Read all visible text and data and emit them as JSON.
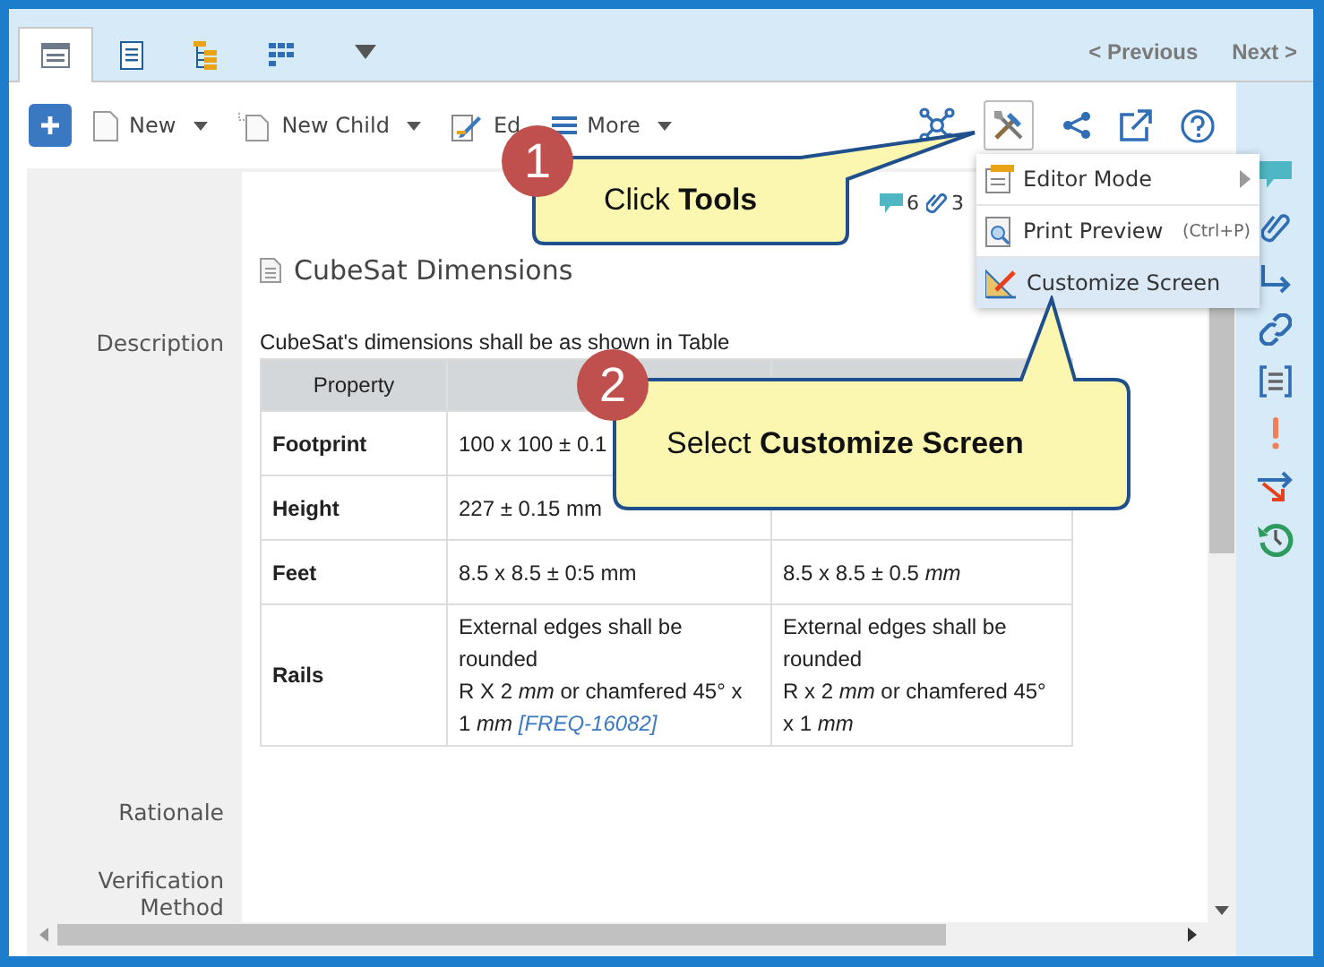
{
  "tabs": [
    {
      "selected": true
    },
    {
      "selected": false
    },
    {
      "selected": false
    },
    {
      "selected": false
    }
  ],
  "navigation": {
    "previous": "< Previous",
    "next": "Next >"
  },
  "toolbar": {
    "buttons": [
      {
        "kind": "new",
        "label": "New",
        "dropdown": true
      },
      {
        "kind": "new-child",
        "label": "New Child",
        "dropdown": true
      },
      {
        "kind": "edit",
        "label": "Ed",
        "dropdown": false
      },
      {
        "kind": "more",
        "label": "More",
        "dropdown": true
      }
    ],
    "tools": {
      "selected": true
    }
  },
  "menu": {
    "items": [
      {
        "kind": "editor",
        "label": "Editor Mode",
        "submenu": true,
        "selected": false
      },
      {
        "kind": "preview",
        "label": "Print Preview",
        "shortcut": "(Ctrl+P)",
        "submenu": false,
        "selected": false
      },
      {
        "kind": "customize",
        "label": "Customize Screen",
        "submenu": false,
        "selected": true
      }
    ]
  },
  "item": {
    "title": "CubeSat Dimensions",
    "comments": "6",
    "attachments": "3"
  },
  "description": {
    "label": "Description",
    "text": "CubeSat's dimensions shall be as shown in Table",
    "table": {
      "columns": [
        "Property"
      ],
      "rows": [
        {
          "name": "Footprint",
          "cells": [
            {
              "lines": [
                "100 x 100 ± 0.1"
              ]
            }
          ]
        },
        {
          "name": "Height",
          "cells": [
            {
              "lines": [
                "227 ± 0.15 mm"
              ]
            }
          ]
        },
        {
          "name": "Feet",
          "cells": [
            {
              "lines": [
                "8.5 x 8.5 ± 0:5 mm"
              ]
            },
            {
              "lines": [
                "8.5 x 8.5 ± 0.5 *mm*"
              ]
            }
          ]
        },
        {
          "name": "Rails",
          "cells": [
            {
              "lines": [
                "External edges shall be rounded",
                "R X 2 *mm* or chamfered 45° x 1 *mm*"
              ],
              "link": "[FREQ-16082]"
            },
            {
              "lines": [
                "External edges shall be rounded",
                "R x 2 *mm* or chamfered 45° x 1 *mm*"
              ]
            }
          ]
        }
      ]
    }
  },
  "fields": [
    {
      "label": "Rationale"
    },
    {
      "label": "Verification Method"
    }
  ],
  "callouts": [
    {
      "number": "1",
      "text": "Click **Tools**"
    },
    {
      "number": "2",
      "text": "Select **Customize Screen**"
    }
  ]
}
